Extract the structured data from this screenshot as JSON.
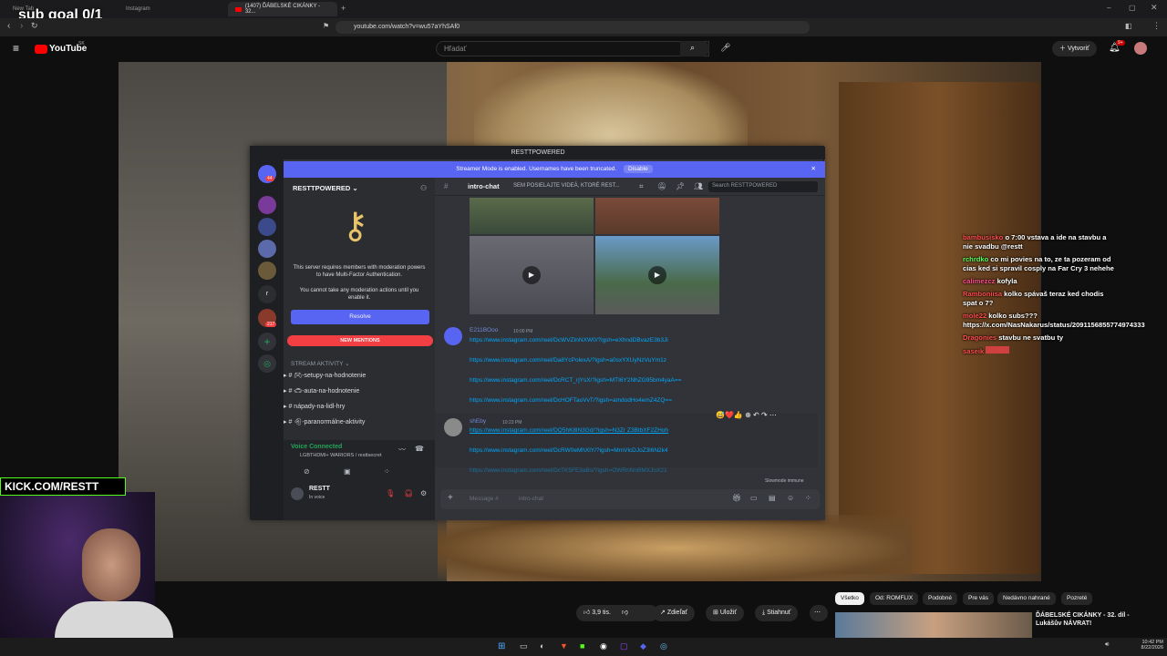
{
  "overlay": {
    "subgoal": "sub goal 0/1",
    "kick": "KICK.COM/RESTT"
  },
  "browser": {
    "tabs": [
      "New Tab",
      "Instagram",
      "(1407) ĎÁBELSKÉ CIKÁNKY - 32..."
    ],
    "url": "youtube.com/watch?v=wu57aYhSAf0"
  },
  "youtube": {
    "logo": "YouTube",
    "region": "SK",
    "search_placeholder": "Hľadať",
    "create": "Vytvoriť",
    "notif_count": "9+",
    "chips": [
      "Všetko",
      "Od: ROMFLIX",
      "Podobné",
      "Pre vás",
      "Nedávno nahrané",
      "Pozreté"
    ],
    "likes": "3,9 tis.",
    "share": "Zdieľať",
    "save": "Uložiť",
    "download": "Stiahnuť",
    "rec_title": "ĎÁBELSKÉ CIKÁNKY - 32. díl - Lukášův NÁVRAT!"
  },
  "discord": {
    "title": "RESTTPOWERED",
    "banner": "Streamer Mode is enabled. Usernames have been truncated.",
    "banner_btn": "Disable",
    "server_name": "RESTTPOWERED",
    "mfa_line1": "This server requires members with moderation powers to have Multi-Factor Authentication.",
    "mfa_line2": "You cannot take any moderation actions until you enable it.",
    "resolve": "Resolve",
    "new_mentions": "NEW MENTIONS",
    "category": "STREAM AKTIVITY",
    "channels": [
      "-setupy-na-hodnotenie",
      "-auta-na-hodnotenie",
      "nápady-na-lidl-hry",
      "-paranormálne-aktivity"
    ],
    "voice_status": "Voice Connected",
    "voice_channel": "LGBTHDMI+ WARIORS / resttsecret",
    "user": "RESTT",
    "user_status": "In voice",
    "channel_header": "intro-chat",
    "channel_topic": "SEM POSIELAJTE VIDEÁ, KTORÉ REST...",
    "search": "Search RESTTPOWERED",
    "rail_badge1": "44",
    "rail_badge2": "217",
    "msg1_user": "E211BOoo",
    "msg1_time": "10:00 PM",
    "msg1_links": [
      "https://www.instagram.com/reel/DcWVZInNXW0/?igsh=eXhndDBvazE3b3Ji",
      "https://www.instagram.com/reel/Da8YcPolexA/?igsh=a0sxYXUyNzVuYm1z",
      "https://www.instagram.com/reel/DcRCT_rjYsX/?igsh=MTI6Y2NhZG95bm4yaA==",
      "https://www.instagram.com/reel/DcHOFTaoVvT/?igsh=amdodHo4emZ4ZQ=="
    ],
    "msg2_user": "shEby",
    "msg2_time": "10:23 PM",
    "msg2_links": [
      "https://www.instagram.com/reel/DQ5hK8lN3Gd/?igsh=N3Zr Z3BtbXF2ZHoh",
      "https://www.instagram.com/reel/DcRW0eMhXlY/?igsh=MmVlcDJoZ3l6N2k4",
      "https://www.instagram.com/reel/DcTK5FE3aBs/?igsh=OWRnNnBMXJoX21"
    ],
    "slowmode": "Slowmode immune",
    "message_placeholder": "Message #",
    "message_channel": "intro-chat"
  },
  "chat": [
    {
      "user": "bambusisko",
      "color": "#ff4d4d",
      "text": "o 7:00 vstava a ide na stavbu a nie svadbu @restt"
    },
    {
      "user": "rchrdko",
      "color": "#5cff5c",
      "text": "co mi povies na to, ze ta pozeram od cias ked si spravil cosply na Far Cry 3 nehehe"
    },
    {
      "user": "calimezcz",
      "color": "#ff4d8a",
      "text": "kofyla"
    },
    {
      "user": "Ramboniisa",
      "color": "#ff4d4d",
      "text": "kolko spávaš teraz ked chodis spat o 7?"
    },
    {
      "user": "mole22",
      "color": "#ff4d4d",
      "text": "kolko subs??? https://x.com/NasNakarus/status/2091156855774974333"
    },
    {
      "user": "Dragonies",
      "color": "#ff4d4d",
      "text": "stavbu ne svatbu ty"
    },
    {
      "user": "saseik",
      "color": "#ff4d4d",
      "text": ""
    }
  ],
  "taskbar": {
    "time": "10:42 PM",
    "date": "8/22/2026"
  }
}
